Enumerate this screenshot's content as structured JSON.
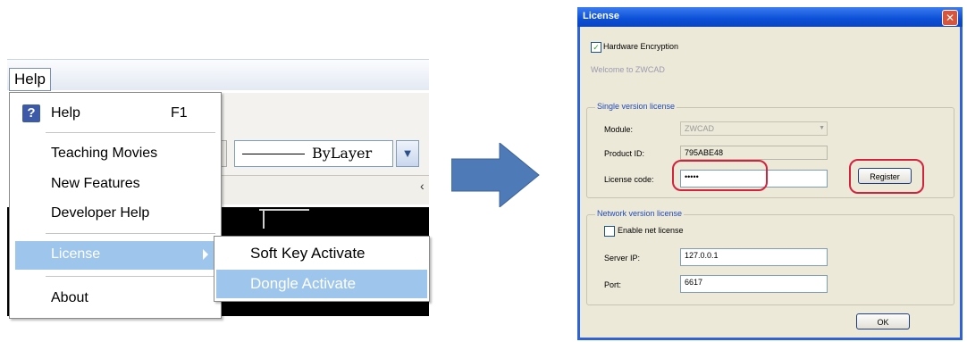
{
  "left_menu": {
    "menubar_label": "Help",
    "items": [
      {
        "label": "Help",
        "shortcut": "F1",
        "icon": "question-icon"
      },
      {
        "label": "Teaching Movies"
      },
      {
        "label": "New Features"
      },
      {
        "label": "Developer Help"
      },
      {
        "label": "License",
        "has_submenu": true,
        "highlighted": true
      },
      {
        "label": "About"
      }
    ],
    "submenu_items": [
      {
        "label": "Soft Key Activate"
      },
      {
        "label": "Dongle Activate",
        "highlighted": true
      }
    ],
    "linetype_combo": "ByLayer",
    "highlight_color": "#9ec5ec"
  },
  "arrow": {
    "color": "#4f7ab8"
  },
  "dialog": {
    "title": "License",
    "hardware_encryption_label": "Hardware Encryption",
    "hardware_encryption_checked": true,
    "welcome_text": "Welcome to ZWCAD",
    "single": {
      "group_title": "Single version license",
      "module_label": "Module:",
      "module_value": "ZWCAD",
      "product_id_label": "Product ID:",
      "product_id_value": "795ABE48",
      "license_code_label": "License code:",
      "license_code_value": "•••••",
      "register_button": "Register"
    },
    "network": {
      "group_title": "Network version license",
      "enable_label": "Enable net license",
      "enable_checked": false,
      "server_ip_label": "Server IP:",
      "server_ip_value": "127.0.0.1",
      "port_label": "Port:",
      "port_value": "6617"
    },
    "ok_button": "OK",
    "title_color": "#0b4fd6",
    "callout_color": "#d4223d"
  }
}
